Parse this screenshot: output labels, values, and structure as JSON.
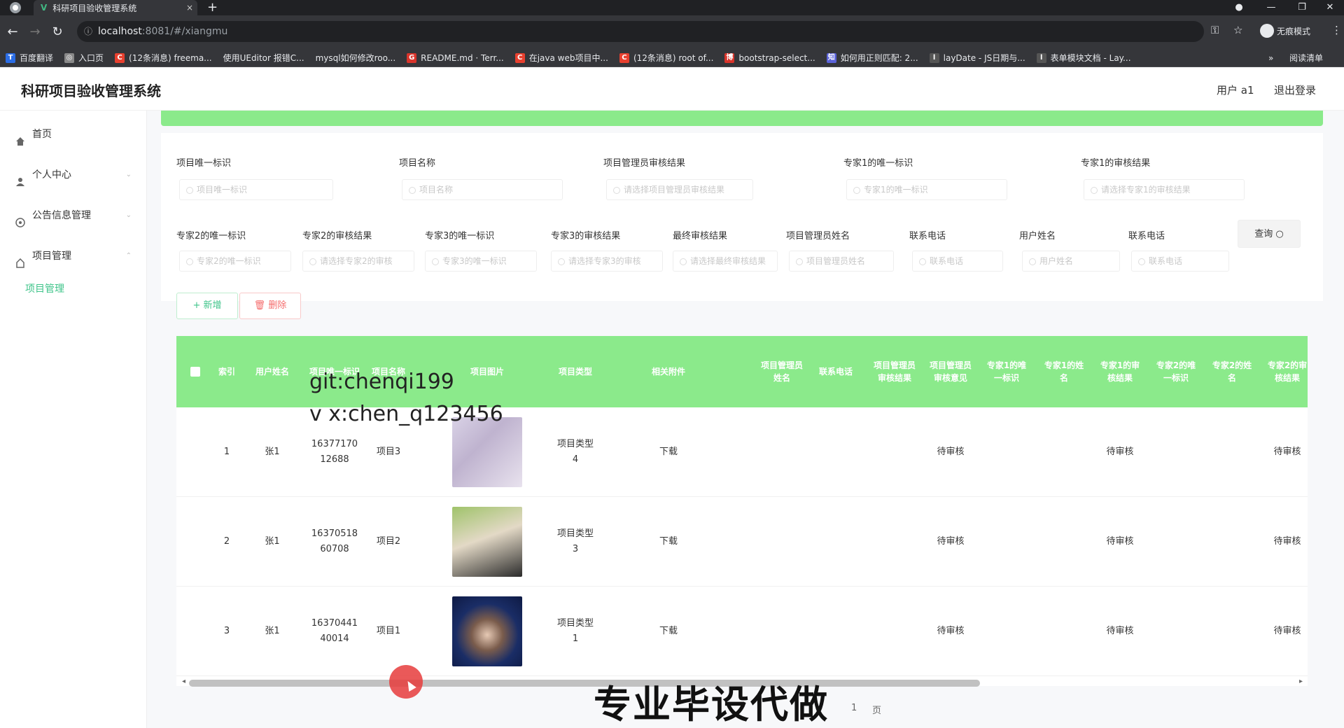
{
  "browser": {
    "tab_title": "科研项目验收管理系统",
    "tab_close": "×",
    "new_tab": "+",
    "url_host": "localhost",
    "url_path": ":8081/#/xiangmu",
    "incognito_label": "无痕模式",
    "bookmarks": [
      {
        "label": "百度翻译",
        "icon": "translate-icon",
        "color": "#2b6de5"
      },
      {
        "label": "入口页",
        "icon": "globe-icon",
        "color": "#888888"
      },
      {
        "label": "(12条消息) freema...",
        "icon": "csdn-icon",
        "color": "#e8402f"
      },
      {
        "label": "使用UEditor 报错C...",
        "icon": "",
        "color": ""
      },
      {
        "label": "mysql如何修改roo...",
        "icon": "",
        "color": ""
      },
      {
        "label": "README.md · Terr...",
        "icon": "gitee-icon",
        "color": "#d9342b"
      },
      {
        "label": "在java web项目中...",
        "icon": "csdn-icon",
        "color": "#e8402f"
      },
      {
        "label": "(12条消息) root of...",
        "icon": "csdn-icon",
        "color": "#e8402f"
      },
      {
        "label": "bootstrap-select...",
        "icon": "cnblogs-icon",
        "color": "#d9342b"
      },
      {
        "label": "如何用正则匹配: 2...",
        "icon": "zhihu-icon",
        "color": "#5b63d9"
      },
      {
        "label": "layDate - JS日期与...",
        "icon": "layui-icon",
        "color": ""
      },
      {
        "label": "表单模块文档 - Lay...",
        "icon": "layui-icon",
        "color": ""
      }
    ],
    "bookmarks_more": "»",
    "reading_list": "阅读清单"
  },
  "app": {
    "title": "科研项目验收管理系统",
    "user": "用户 a1",
    "logout": "退出登录",
    "accent": "#3fc48a",
    "header_green": "#8bea8b"
  },
  "sidebar": {
    "items": [
      {
        "label": "首页",
        "icon": "home-icon"
      },
      {
        "label": "个人中心",
        "icon": "user-icon"
      },
      {
        "label": "公告信息管理",
        "icon": "notice-icon"
      },
      {
        "label": "项目管理",
        "icon": "project-icon"
      }
    ],
    "active_sub": "项目管理"
  },
  "search": {
    "row1": [
      {
        "label": "项目唯一标识",
        "placeholder": "项目唯一标识"
      },
      {
        "label": "项目名称",
        "placeholder": "项目名称"
      },
      {
        "label": "项目管理员审核结果",
        "placeholder": "请选择项目管理员审核结果"
      },
      {
        "label": "专家1的唯一标识",
        "placeholder": "专家1的唯一标识"
      },
      {
        "label": "专家1的审核结果",
        "placeholder": "请选择专家1的审核结果"
      }
    ],
    "row2": [
      {
        "label": "专家2的唯一标识",
        "placeholder": "专家2的唯一标识"
      },
      {
        "label": "专家2的审核结果",
        "placeholder": "请选择专家2的审核"
      },
      {
        "label": "专家3的唯一标识",
        "placeholder": "专家3的唯一标识"
      },
      {
        "label": "专家3的审核结果",
        "placeholder": "请选择专家3的审核"
      },
      {
        "label": "最终审核结果",
        "placeholder": "请选择最终审核结果"
      },
      {
        "label": "项目管理员姓名",
        "placeholder": "项目管理员姓名"
      },
      {
        "label": "联系电话",
        "placeholder": "联系电话"
      },
      {
        "label": "用户姓名",
        "placeholder": "用户姓名"
      },
      {
        "label": "联系电话",
        "placeholder": "联系电话"
      }
    ],
    "query_button": "查询"
  },
  "actions": {
    "add": "+ 新增",
    "delete": "删除"
  },
  "table": {
    "headers": [
      "索引",
      "用户姓名",
      "项目唯一标识",
      "项目名称",
      "项目图片",
      "项目类型",
      "相关附件",
      "项目管理员姓名",
      "联系电话",
      "项目管理员审核结果",
      "项目管理员审核意见",
      "专家1的唯一标识",
      "专家1的姓名",
      "专家1的审核结果",
      "专家2的唯一标识",
      "专家2的姓名",
      "专家2的审核结果"
    ],
    "rows": [
      {
        "index": "1",
        "user": "张1",
        "id": "1637717012688",
        "name": "项目3",
        "type": "项目类型4",
        "file": "下载",
        "s1": "待审核",
        "s2": "待审核",
        "s3": "待审核"
      },
      {
        "index": "2",
        "user": "张1",
        "id": "1637051860708",
        "name": "项目2",
        "type": "项目类型3",
        "file": "下载",
        "s1": "待审核",
        "s2": "待审核",
        "s3": "待审核"
      },
      {
        "index": "3",
        "user": "张1",
        "id": "1637044140014",
        "name": "项目1",
        "type": "项目类型1",
        "file": "下载",
        "s1": "待审核",
        "s2": "待审核",
        "s3": "待审核"
      }
    ]
  },
  "pager": {
    "page": "1",
    "unit": "页"
  },
  "overlays": {
    "git": "git:chenqi199",
    "vx": "v x:chen_q123456",
    "watermark": "专业毕设代做"
  }
}
